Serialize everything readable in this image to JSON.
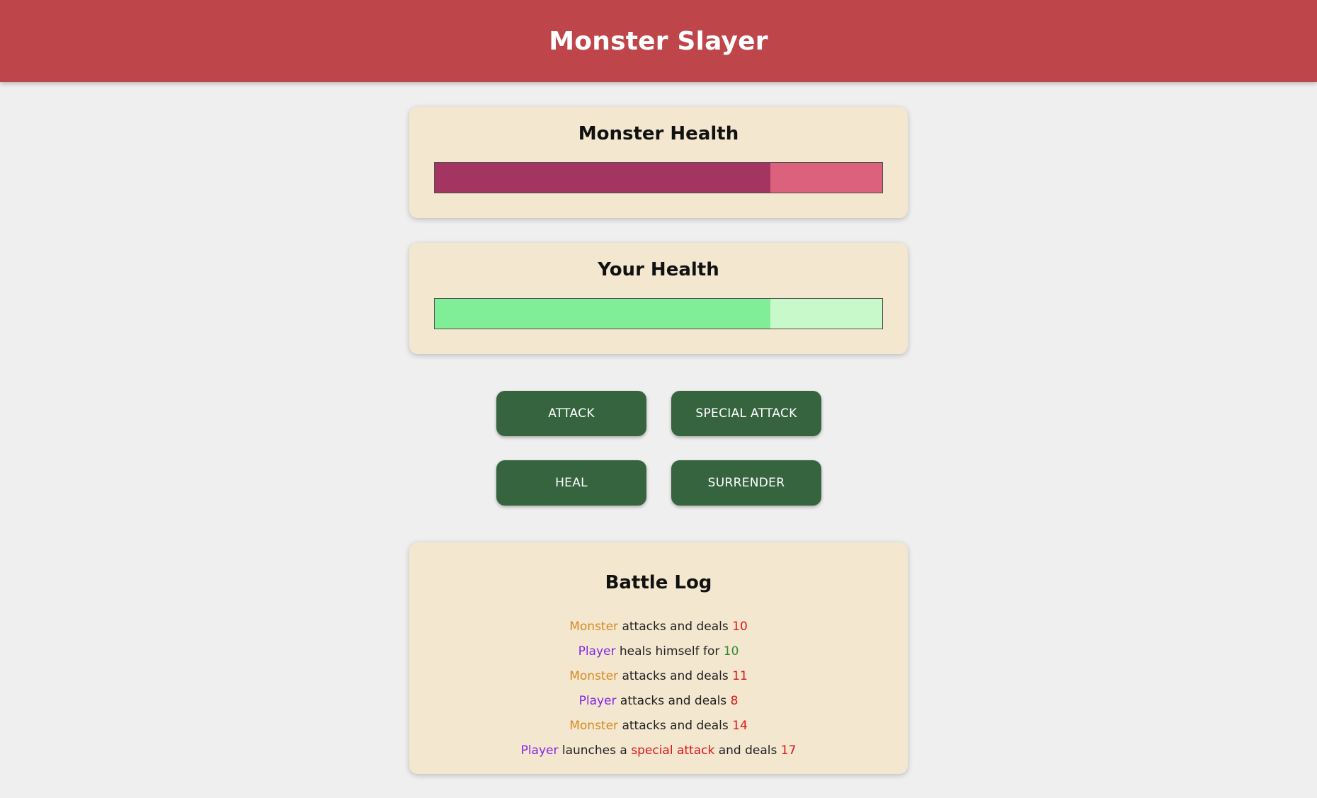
{
  "header": {
    "title": "Monster Slayer"
  },
  "monster": {
    "title": "Monster Health",
    "health_fraction": 0.75,
    "colors": {
      "fill": "#a33560",
      "empty": "#dc617c"
    }
  },
  "player": {
    "title": "Your Health",
    "health_fraction": 0.75,
    "colors": {
      "fill": "#7fee96",
      "empty": "#c8f9cb"
    }
  },
  "actions": {
    "attack": "ATTACK",
    "special_attack": "SPECIAL ATTACK",
    "heal": "HEAL",
    "surrender": "SURRENDER"
  },
  "log": {
    "title": "Battle Log",
    "entries": [
      {
        "actor": "Monster",
        "parts": [
          {
            "text": " attacks and deals ",
            "kind": "plain"
          },
          {
            "text": "10",
            "kind": "damage"
          }
        ]
      },
      {
        "actor": "Player",
        "parts": [
          {
            "text": " heals himself for ",
            "kind": "plain"
          },
          {
            "text": "10",
            "kind": "heal"
          }
        ]
      },
      {
        "actor": "Monster",
        "parts": [
          {
            "text": " attacks and deals ",
            "kind": "plain"
          },
          {
            "text": "11",
            "kind": "damage"
          }
        ]
      },
      {
        "actor": "Player",
        "parts": [
          {
            "text": " attacks and deals ",
            "kind": "plain"
          },
          {
            "text": "8",
            "kind": "damage"
          }
        ]
      },
      {
        "actor": "Monster",
        "parts": [
          {
            "text": " attacks and deals ",
            "kind": "plain"
          },
          {
            "text": "14",
            "kind": "damage"
          }
        ]
      },
      {
        "actor": "Player",
        "parts": [
          {
            "text": " launches a ",
            "kind": "plain"
          },
          {
            "text": "special attack",
            "kind": "special"
          },
          {
            "text": " and deals ",
            "kind": "plain"
          },
          {
            "text": "17",
            "kind": "damage"
          }
        ]
      }
    ]
  },
  "colors": {
    "header_bg": "#be4549",
    "card_bg": "#f3e7cf",
    "button_bg": "#35643f",
    "monster_name": "#d8891d",
    "player_name": "#8425e0",
    "damage": "#e01515",
    "heal": "#2f8a2f"
  }
}
